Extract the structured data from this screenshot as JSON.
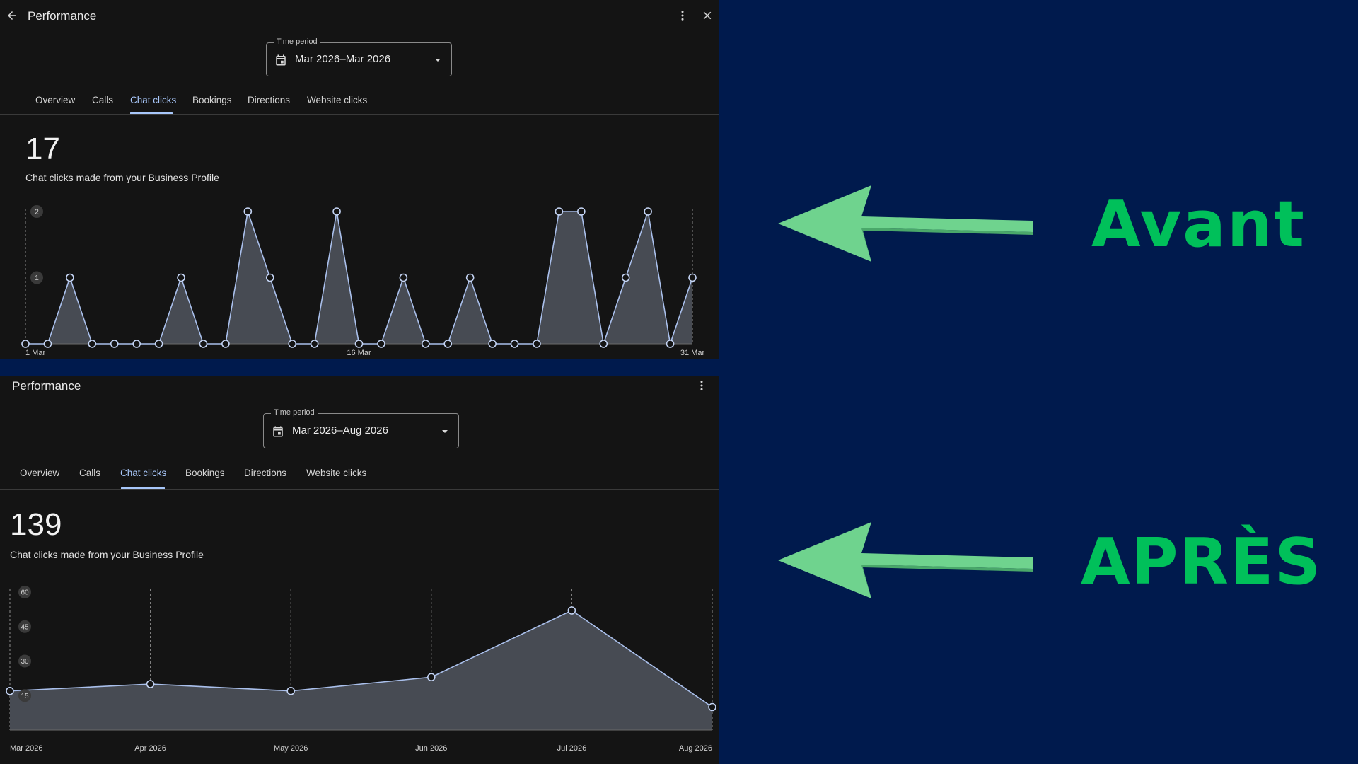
{
  "top": {
    "title": "Performance",
    "time_period_label": "Time period",
    "time_period_value": "Mar 2026–Mar 2026",
    "tabs": [
      "Overview",
      "Calls",
      "Chat clicks",
      "Bookings",
      "Directions",
      "Website clicks"
    ],
    "active_tab": "Chat clicks",
    "total": "17",
    "subtitle": "Chat clicks made from your Business Profile"
  },
  "bottom": {
    "title": "Performance",
    "time_period_label": "Time period",
    "time_period_value": "Mar 2026–Aug 2026",
    "tabs": [
      "Overview",
      "Calls",
      "Chat clicks",
      "Bookings",
      "Directions",
      "Website clicks"
    ],
    "active_tab": "Chat clicks",
    "total": "139",
    "subtitle": "Chat clicks made from your Business Profile"
  },
  "labels": {
    "before": "Avant",
    "after": "APRÈS"
  },
  "colors": {
    "accent": "#a8c7fa",
    "label_green": "#00c05a",
    "arrow_green": "#6fd38e",
    "background": "#001a4d"
  },
  "chart_data": [
    {
      "type": "area",
      "x": [
        "1 Mar",
        "2 Mar",
        "3 Mar",
        "4 Mar",
        "5 Mar",
        "6 Mar",
        "7 Mar",
        "8 Mar",
        "9 Mar",
        "10 Mar",
        "11 Mar",
        "12 Mar",
        "13 Mar",
        "14 Mar",
        "15 Mar",
        "16 Mar",
        "17 Mar",
        "18 Mar",
        "19 Mar",
        "20 Mar",
        "21 Mar",
        "22 Mar",
        "23 Mar",
        "24 Mar",
        "25 Mar",
        "26 Mar",
        "27 Mar",
        "28 Mar",
        "29 Mar",
        "30 Mar",
        "31 Mar"
      ],
      "values": [
        0,
        0,
        1,
        0,
        0,
        0,
        0,
        1,
        0,
        0,
        2,
        1,
        0,
        0,
        2,
        0,
        0,
        1,
        0,
        0,
        1,
        0,
        0,
        0,
        2,
        2,
        0,
        1,
        2,
        0,
        1
      ],
      "x_tick_labels": [
        "1 Mar",
        "16 Mar",
        "31 Mar"
      ],
      "y_ticks": [
        1,
        2
      ],
      "ylim": [
        0,
        2
      ],
      "grid": "vertical dashed at tick labels"
    },
    {
      "type": "area",
      "x": [
        "Mar 2026",
        "Apr 2026",
        "May 2026",
        "Jun 2026",
        "Jul 2026",
        "Aug 2026"
      ],
      "values": [
        17,
        20,
        17,
        23,
        52,
        10
      ],
      "x_tick_labels": [
        "Mar 2026",
        "Apr 2026",
        "May 2026",
        "Jun 2026",
        "Jul 2026",
        "Aug 2026"
      ],
      "y_ticks": [
        15,
        30,
        45,
        60
      ],
      "ylim": [
        0,
        60
      ],
      "grid": "vertical dashed at each month"
    }
  ]
}
